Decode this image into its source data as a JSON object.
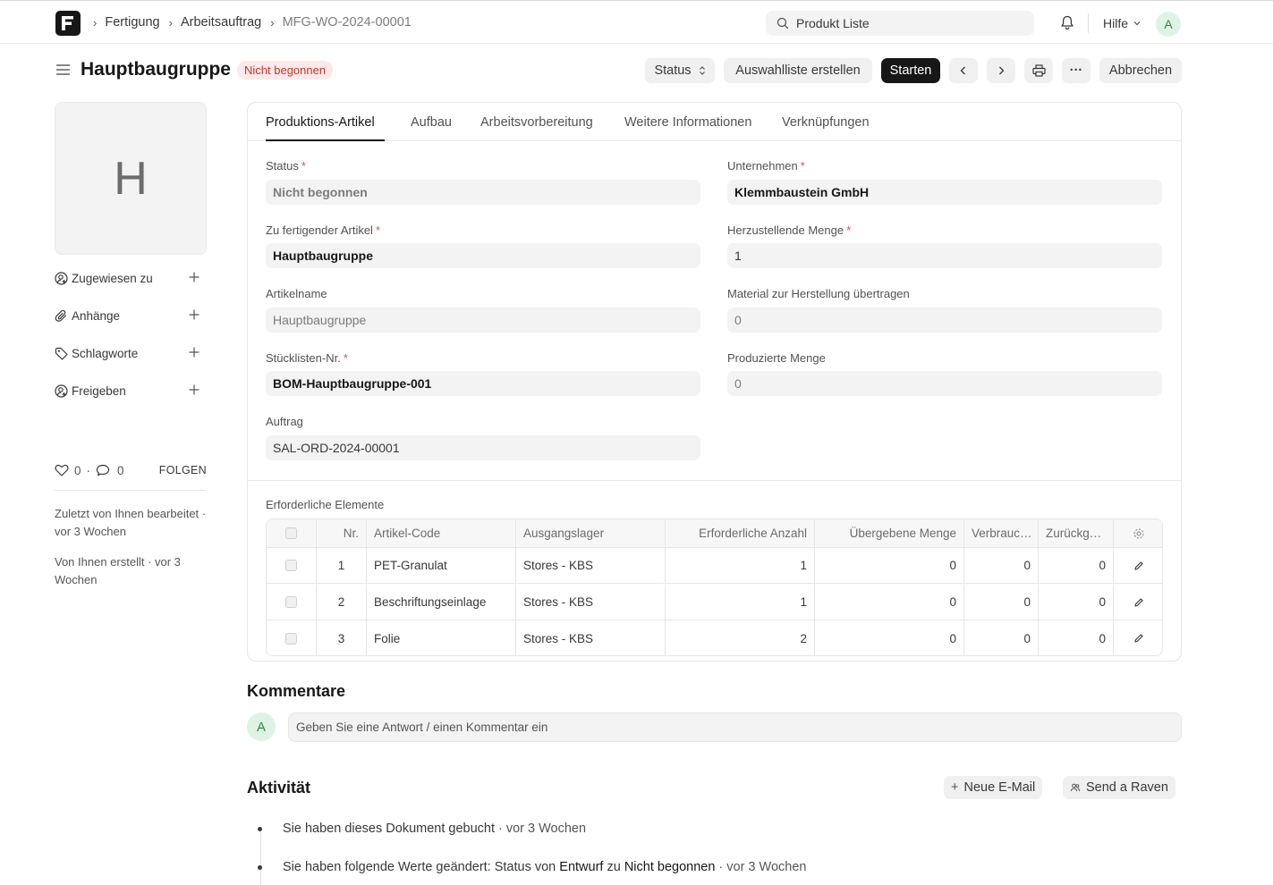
{
  "nav": {
    "breadcrumbs": [
      "Fertigung",
      "Arbeitsauftrag",
      "MFG-WO-2024-00001"
    ],
    "search_placeholder": "Produkt Liste",
    "help_label": "Hilfe",
    "avatar_initial": "A"
  },
  "header": {
    "title": "Hauptbaugruppe",
    "status_pill": "Nicht begonnen",
    "buttons": {
      "status": "Status",
      "pick_list": "Auswahlliste erstellen",
      "start": "Starten",
      "more": "···",
      "cancel": "Abbrechen"
    }
  },
  "sidebar": {
    "image_letter": "H",
    "items": [
      {
        "label": "Zugewiesen zu",
        "icon": "user-plus-icon"
      },
      {
        "label": "Anhänge",
        "icon": "paperclip-icon"
      },
      {
        "label": "Schlagworte",
        "icon": "tag-icon"
      },
      {
        "label": "Freigeben",
        "icon": "share-user-icon"
      }
    ],
    "likes": "0",
    "comments": "0",
    "follow_label": "FOLGEN",
    "modified_note": "Zuletzt von Ihnen bearbeitet · vor 3 Wochen",
    "created_note": "Von Ihnen erstellt · vor 3 Wochen"
  },
  "tabs": [
    "Produktions-Artikel",
    "Aufbau",
    "Arbeitsvorbereitung",
    "Weitere Informationen",
    "Verknüpfungen"
  ],
  "form": {
    "status": {
      "label": "Status",
      "value": "Nicht begonnen"
    },
    "company": {
      "label": "Unternehmen",
      "value": "Klemmbaustein GmbH"
    },
    "item": {
      "label": "Zu fertigender Artikel",
      "value": "Hauptbaugruppe"
    },
    "qty": {
      "label": "Herzustellende Menge",
      "value": "1"
    },
    "item_name": {
      "label": "Artikelname",
      "value": "Hauptbaugruppe"
    },
    "material_transferred": {
      "label": "Material zur Herstellung übertragen",
      "value": "0"
    },
    "bom": {
      "label": "Stücklisten-Nr.",
      "value": "BOM-Hauptbaugruppe-001"
    },
    "produced": {
      "label": "Produzierte Menge",
      "value": "0"
    },
    "sales_order": {
      "label": "Auftrag",
      "value": "SAL-ORD-2024-00001"
    }
  },
  "required_items": {
    "section_label": "Erforderliche Elemente",
    "columns": [
      "Nr.",
      "Artikel-Code",
      "Ausgangslager",
      "Erforderliche Anzahl",
      "Übergebene Menge",
      "Verbrauc…",
      "Zurückg…"
    ],
    "rows": [
      {
        "no": "1",
        "item_code": "PET-Granulat",
        "warehouse": "Stores - KBS",
        "required": "1",
        "transferred": "0",
        "consumed": "0",
        "returned": "0"
      },
      {
        "no": "2",
        "item_code": "Beschriftungseinlage",
        "warehouse": "Stores - KBS",
        "required": "1",
        "transferred": "0",
        "consumed": "0",
        "returned": "0"
      },
      {
        "no": "3",
        "item_code": "Folie",
        "warehouse": "Stores - KBS",
        "required": "2",
        "transferred": "0",
        "consumed": "0",
        "returned": "0"
      }
    ]
  },
  "comments": {
    "heading": "Kommentare",
    "avatar_initial": "A",
    "placeholder": "Geben Sie eine Antwort / einen Kommentar ein"
  },
  "activity": {
    "heading": "Aktivität",
    "new_email": "Neue E-Mail",
    "send_raven": "Send a Raven",
    "entries": [
      {
        "text": "Sie haben dieses Dokument gebucht",
        "time": "· vor 3 Wochen"
      },
      {
        "prefix": "Sie haben folgende Werte geändert: Status von ",
        "from": "Entwurf",
        "mid": " zu ",
        "to": "Nicht begonnen",
        "time": "· vor 3 Wochen"
      }
    ]
  }
}
